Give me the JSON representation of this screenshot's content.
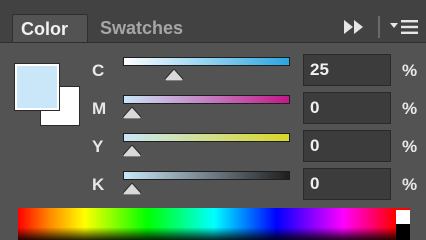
{
  "tabs": [
    {
      "label": "Color",
      "active": true
    },
    {
      "label": "Swatches",
      "active": false
    }
  ],
  "toolbar": {
    "collapse_icon": "double-chevron-right-icon",
    "menu_icon": "panel-menu-icon"
  },
  "swatches": {
    "foreground_color": "#c9e7f8",
    "background_color": "#ffffff"
  },
  "channels": [
    {
      "label": "C",
      "value": "25",
      "unit": "%",
      "level": 0.25
    },
    {
      "label": "M",
      "value": "0",
      "unit": "%",
      "level": 0
    },
    {
      "label": "Y",
      "value": "0",
      "unit": "%",
      "level": 0
    },
    {
      "label": "K",
      "value": "0",
      "unit": "%",
      "level": 0
    }
  ],
  "colors": {
    "panel": "#535353",
    "tabbar": "#424242",
    "cyan": "#2aa6e0",
    "magenta": "#c2188a",
    "yellow": "#d8d626",
    "black": "#1e1e1e"
  }
}
